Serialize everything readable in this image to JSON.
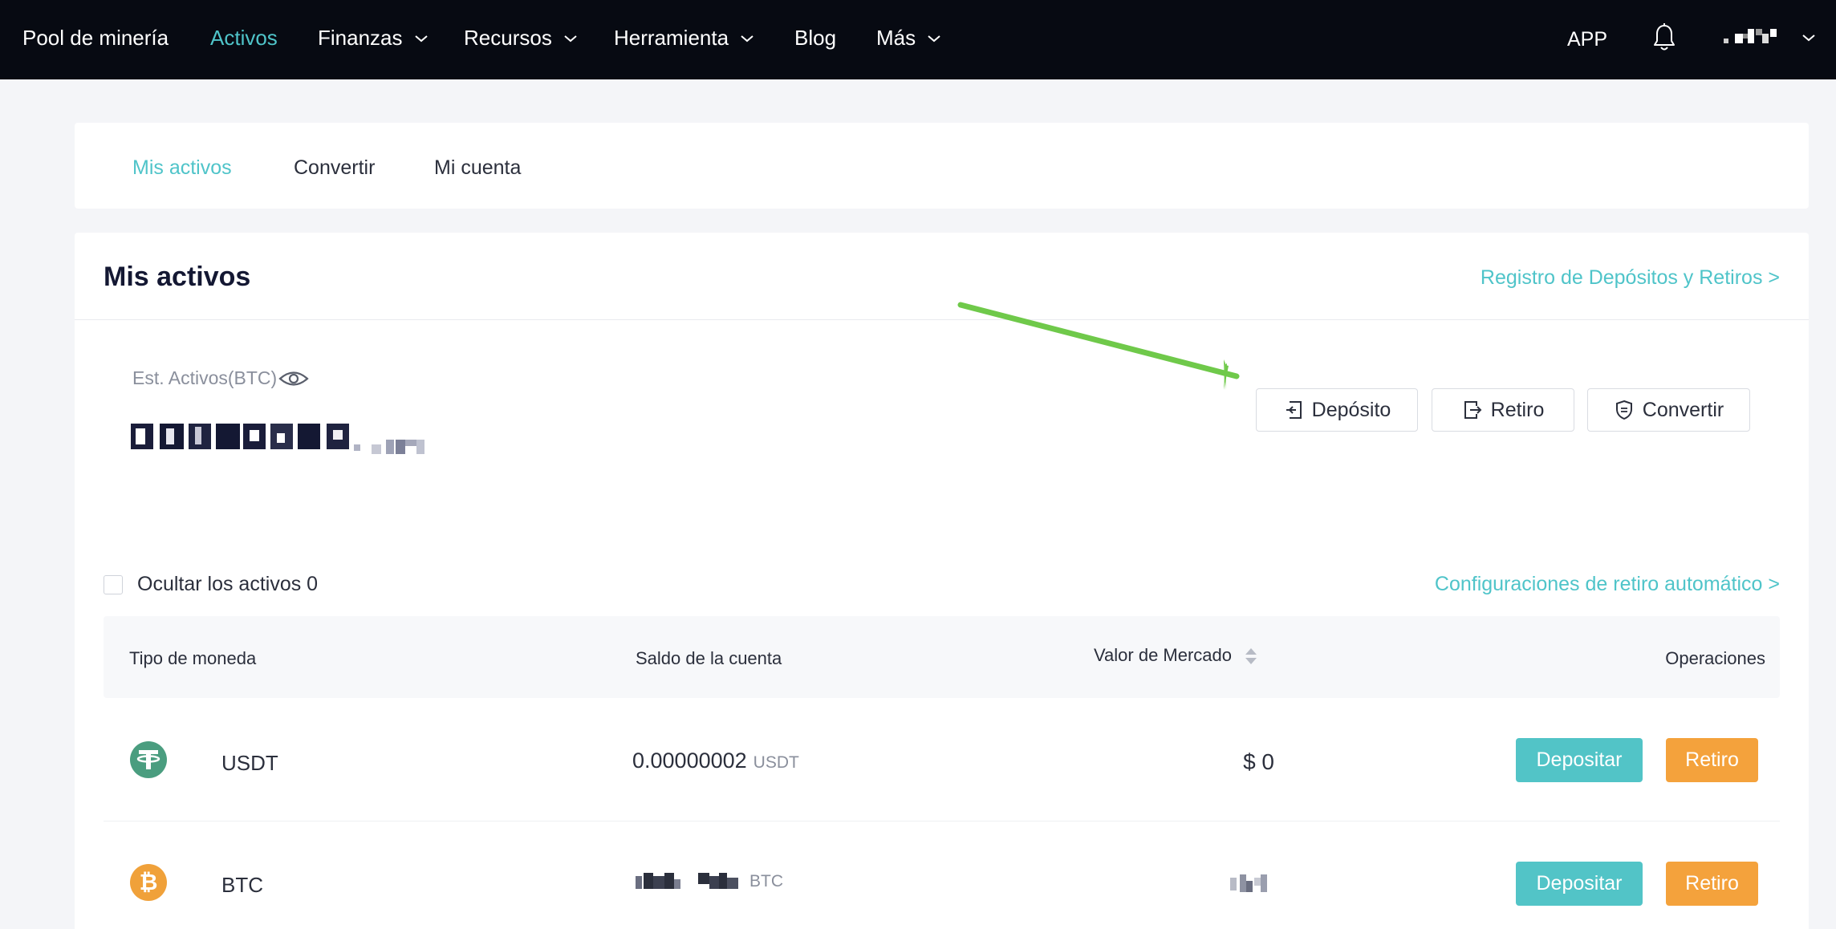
{
  "nav": {
    "brand": "Pool de minería",
    "items": [
      {
        "label": "Activos",
        "active": true,
        "dropdown": false
      },
      {
        "label": "Finanzas",
        "active": false,
        "dropdown": true
      },
      {
        "label": "Recursos",
        "active": false,
        "dropdown": true
      },
      {
        "label": "Herramienta",
        "active": false,
        "dropdown": true
      },
      {
        "label": "Blog",
        "active": false,
        "dropdown": false
      },
      {
        "label": "Más",
        "active": false,
        "dropdown": true
      }
    ],
    "app_label": "APP",
    "icons": {
      "notifications": "bell-icon",
      "account_menu": "chevron-down-icon"
    }
  },
  "tabs": [
    {
      "label": "Mis activos",
      "active": true
    },
    {
      "label": "Convertir",
      "active": false
    },
    {
      "label": "Mi cuenta",
      "active": false
    }
  ],
  "assets": {
    "title": "Mis activos",
    "records_link": "Registro de Depósitos y Retiros >",
    "est_label": "Est. Activos(BTC)",
    "actions": {
      "deposit": "Depósito",
      "withdraw": "Retiro",
      "convert": "Convertir"
    },
    "hide_label": "Ocultar los activos 0",
    "auto_withdraw_link": "Configuraciones de retiro automático >"
  },
  "table": {
    "headers": {
      "currency": "Tipo de moneda",
      "balance": "Saldo de la cuenta",
      "market": "Valor de Mercado",
      "ops": "Operaciones"
    },
    "rows": [
      {
        "coin": "USDT",
        "balance": "0.00000002",
        "unit": "USDT",
        "market": "$ 0",
        "deposit": "Depositar",
        "withdraw": "Retiro",
        "color": "#4a9d7f"
      },
      {
        "coin": "BTC",
        "balance": "",
        "unit": "BTC",
        "market": "",
        "deposit": "Depositar",
        "withdraw": "Retiro",
        "color": "#f0a13a"
      }
    ]
  },
  "colors": {
    "accent": "#4fc4c9",
    "deposit_button": "#52c4c7",
    "withdraw_button": "#f4a23c",
    "annotation_arrow": "#6fc94a",
    "nav_background": "#070a12"
  }
}
